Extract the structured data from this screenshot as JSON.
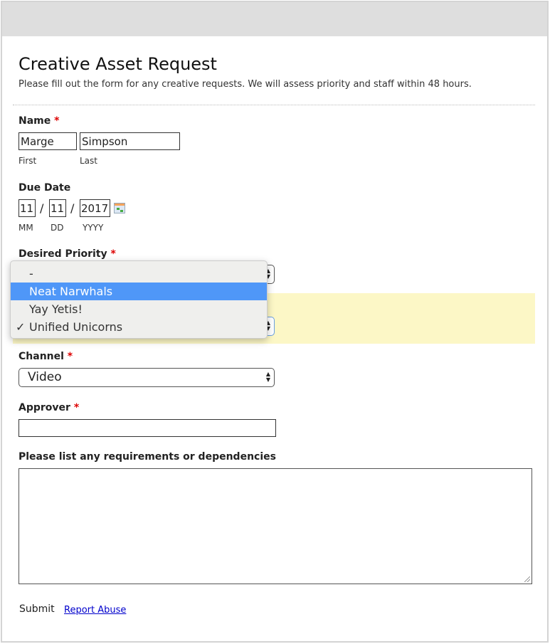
{
  "form": {
    "title": "Creative Asset Request",
    "description": "Please fill out the form for any creative requests. We will assess priority and staff within 48 hours.",
    "required_marker": "*",
    "name": {
      "label": "Name",
      "first_value": "Marge",
      "last_value": "Simpson",
      "first_sublabel": "First",
      "last_sublabel": "Last"
    },
    "due_date": {
      "label": "Due Date",
      "mm": "11",
      "dd": "11",
      "yyyy": "2017",
      "separator": "/",
      "mm_sublabel": "MM",
      "dd_sublabel": "DD",
      "yyyy_sublabel": "YYYY",
      "icon": "calendar-icon"
    },
    "priority": {
      "label": "Desired Priority",
      "options": [
        "-",
        "Neat Narwhals",
        "Yay Yetis!",
        "Unified Unicorns"
      ],
      "highlighted_option": "Neat Narwhals",
      "checked_option": "Unified Unicorns",
      "check_glyph": "✓"
    },
    "channel": {
      "label": "Channel",
      "value": "Video"
    },
    "approver": {
      "label": "Approver",
      "value": ""
    },
    "requirements": {
      "label": "Please list any requirements or dependencies",
      "value": ""
    },
    "submit_label": "Submit",
    "report_abuse_label": "Report Abuse"
  },
  "colors": {
    "highlight": "#fcf7c6",
    "selected_option": "#4f97f8",
    "required": "#dd0000",
    "link": "#0000cc"
  }
}
